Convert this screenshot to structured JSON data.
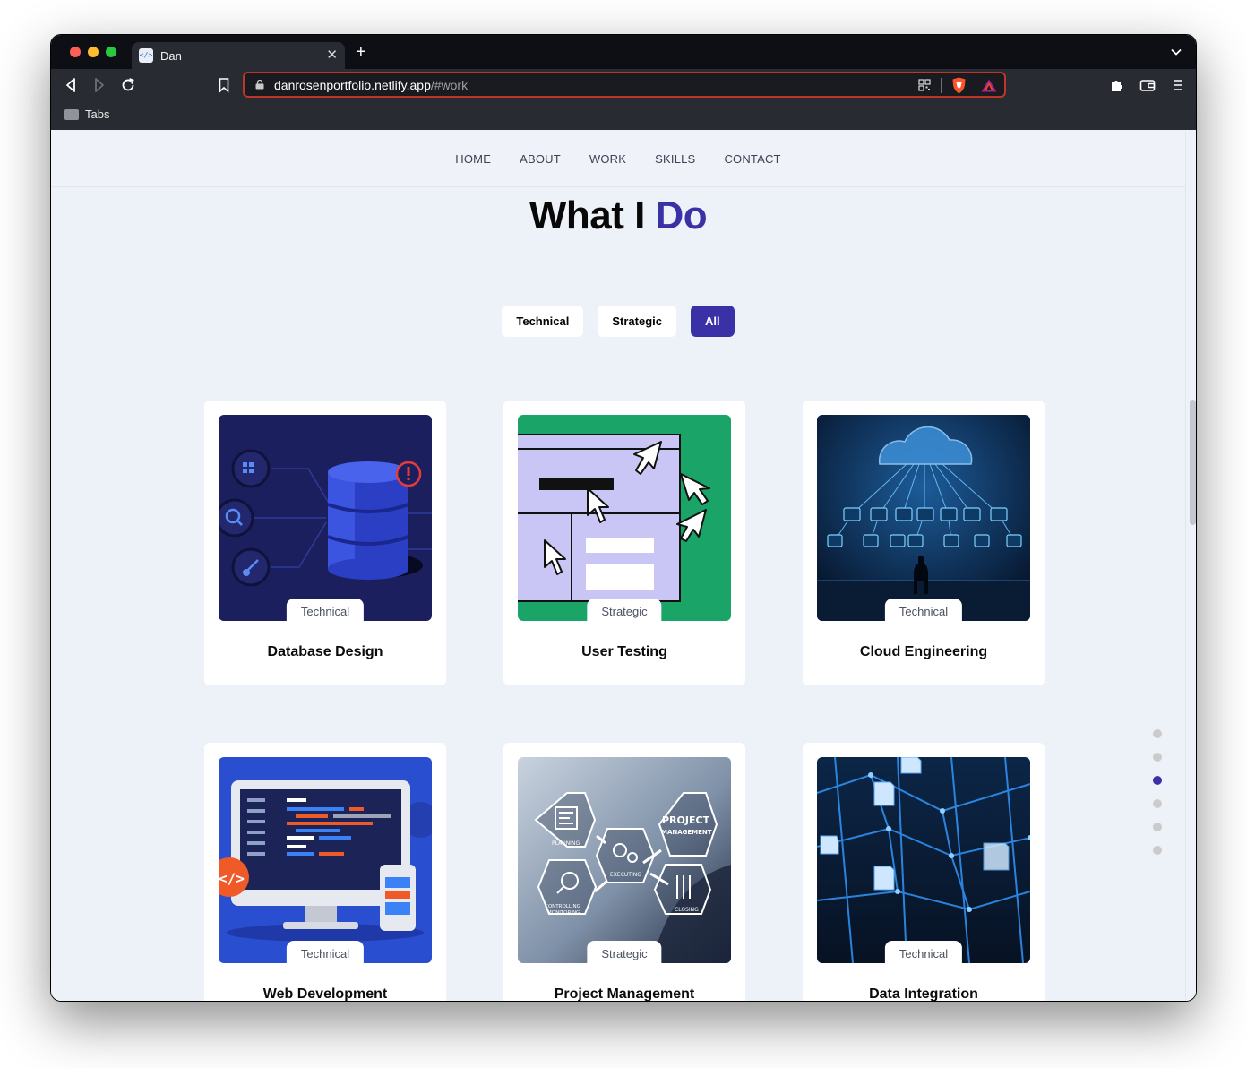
{
  "browser": {
    "tab_title": "Dan",
    "tab_favicon": "</>",
    "tab_close": "✕",
    "new_tab": "+",
    "url_domain": "danrosenportfolio.netlify.app",
    "url_path": "/#work",
    "bookmark_folder": "Tabs"
  },
  "nav": {
    "items": [
      "HOME",
      "ABOUT",
      "WORK",
      "SKILLS",
      "CONTACT"
    ]
  },
  "section": {
    "title_main": "What I ",
    "title_accent": "Do"
  },
  "filters": {
    "items": [
      "Technical",
      "Strategic",
      "All"
    ],
    "active": "All"
  },
  "cards": [
    {
      "title": "Database Design",
      "tag": "Technical",
      "image": "database-illustration"
    },
    {
      "title": "User Testing",
      "tag": "Strategic",
      "image": "user-testing-illustration"
    },
    {
      "title": "Cloud Engineering",
      "tag": "Technical",
      "image": "cloud-network-photo"
    },
    {
      "title": "Web Development",
      "tag": "Technical",
      "image": "web-dev-illustration"
    },
    {
      "title": "Project Management",
      "tag": "Strategic",
      "image": "project-management-photo"
    },
    {
      "title": "Data Integration",
      "tag": "Technical",
      "image": "data-network-photo"
    }
  ],
  "dot_nav": {
    "count": 6,
    "active_index": 2
  },
  "colors": {
    "accent": "#3a31a6",
    "page_bg": "#edf1f8",
    "card_bg": "#ffffff"
  }
}
